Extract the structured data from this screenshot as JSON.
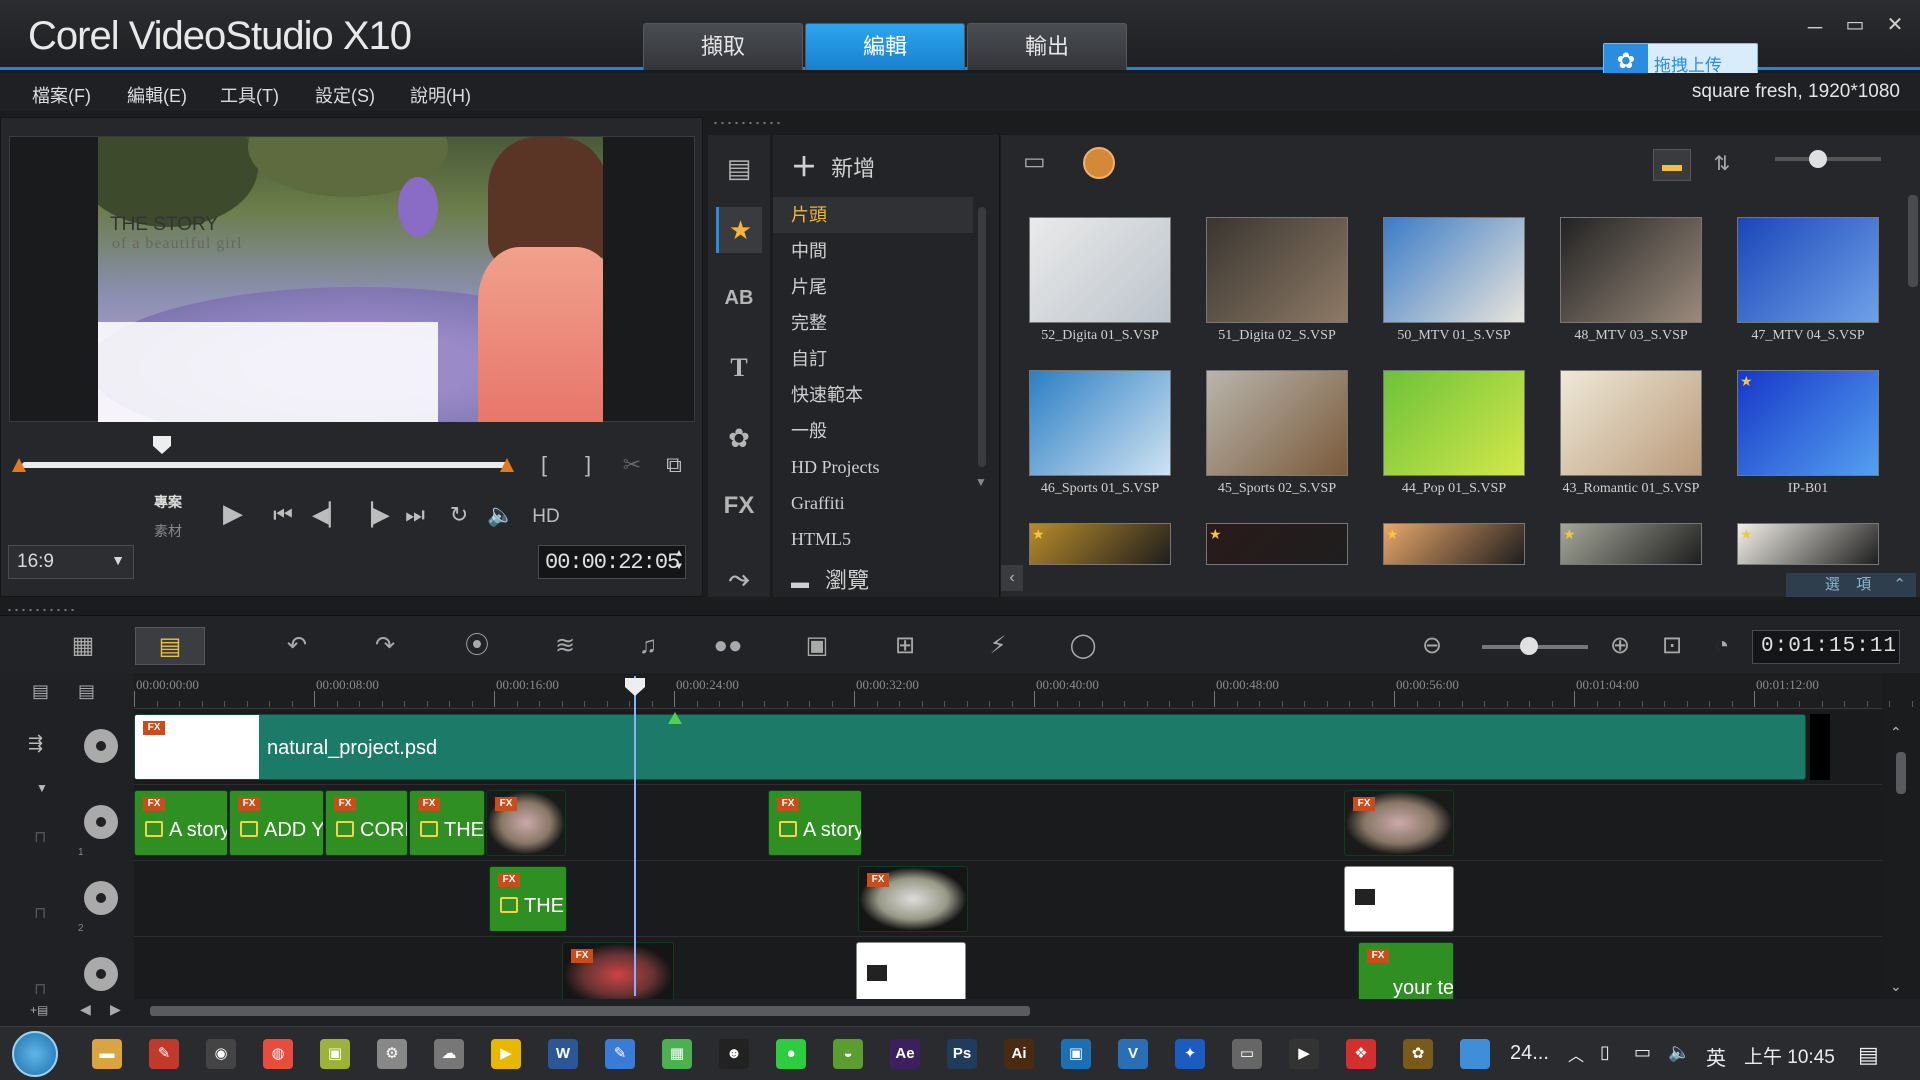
{
  "app": {
    "logo": "Corel VideoStudio X10",
    "mode_tabs": [
      "擷取",
      "編輯",
      "輸出"
    ],
    "active_tab": "編輯",
    "window_controls": [
      "－",
      "▭",
      "✕"
    ],
    "cloud_upload_label": "拖拽上传",
    "project_info": "square fresh, 1920*1080"
  },
  "menu": [
    "檔案(F)",
    "編輯(E)",
    "工具(T)",
    "設定(S)",
    "說明(H)"
  ],
  "player": {
    "preview_title": "THE STORY",
    "preview_subtitle": "of a beautiful girl",
    "mode_project": "專案",
    "mode_clip": "素材",
    "aspect_ratio": "16:9",
    "timecode": "00:00:22:05",
    "hd_label": "HD",
    "mark_in": "[",
    "mark_out": "]"
  },
  "library": {
    "add_label": "新增",
    "browse_label": "瀏覽",
    "options_label": "選 項",
    "categories": [
      "片頭",
      "中間",
      "片尾",
      "完整",
      "自訂",
      "快速範本",
      "一般",
      "HD Projects",
      "Graffiti",
      "HTML5"
    ],
    "selected_category": "片頭",
    "side_tools": [
      "media",
      "instant-project",
      "AB",
      "T",
      "graphics",
      "FX",
      "path"
    ],
    "thumbnails": [
      {
        "label": "52_Digita 01_S.VSP",
        "colors": [
          "#eaeaea",
          "#bcc4cc"
        ],
        "fav": false
      },
      {
        "label": "51_Digita 02_S.VSP",
        "colors": [
          "#3a3530",
          "#8d7a66"
        ],
        "fav": false
      },
      {
        "label": "50_MTV 01_S.VSP",
        "colors": [
          "#3a7cc7",
          "#e9e4dc"
        ],
        "fav": false
      },
      {
        "label": "48_MTV 03_S.VSP",
        "colors": [
          "#222222",
          "#9a8a7c"
        ],
        "fav": false
      },
      {
        "label": "47_MTV 04_S.VSP",
        "colors": [
          "#1a46b8",
          "#6fa1e8"
        ],
        "fav": false
      },
      {
        "label": "46_Sports 01_S.VSP",
        "colors": [
          "#2b7fc4",
          "#cfe3f2"
        ],
        "fav": false
      },
      {
        "label": "45_Sports 02_S.VSP",
        "colors": [
          "#b9b5ad",
          "#7a5a3a"
        ],
        "fav": false
      },
      {
        "label": "44_Pop 01_S.VSP",
        "colors": [
          "#6cc23a",
          "#d4e84a"
        ],
        "fav": false
      },
      {
        "label": "43_Romantic 01_S.VSP",
        "colors": [
          "#efe9d8",
          "#b99a7a"
        ],
        "fav": false
      },
      {
        "label": "IP-B01",
        "colors": [
          "#1638c8",
          "#55a0f0"
        ],
        "fav": true
      }
    ],
    "partial_row_colors": [
      "#b88a2a",
      "#2a1a1a",
      "#e9a66a",
      "#a5a79a",
      "#f3f0e8"
    ]
  },
  "timeline": {
    "duration": "0:01:15:11",
    "ruler_labels": [
      "00:00:00:00",
      "00:00:08:00",
      "00:00:16:00",
      "00:00:24:00",
      "00:00:32:00",
      "00:00:40:00",
      "00:00:48:00",
      "00:00:56:00",
      "00:01:04:00",
      "00:01:12:00"
    ],
    "video_clip_label": "natural_project.psd",
    "overlay1_texts": [
      "A story",
      "ADD Y",
      "CORI",
      "THE",
      "A story"
    ],
    "overlay2_text": "THE",
    "overlay3_text": "your te",
    "track_numbers": [
      "1",
      "2"
    ]
  },
  "taskbar": {
    "weather": "24...",
    "ime": "英",
    "time": "上午 10:45"
  }
}
